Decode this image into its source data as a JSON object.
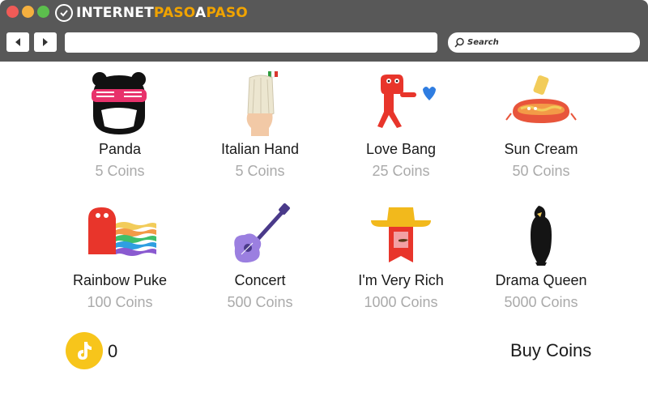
{
  "brand": {
    "name_part1": "INTERNET",
    "name_part2": "PASO",
    "name_part3": "A",
    "name_part4": "PASO",
    "accent_color": "#f0a300"
  },
  "toolbar": {
    "back_icon": "back-arrow-icon",
    "forward_icon": "forward-arrow-icon",
    "address_value": "",
    "search_placeholder": "Search"
  },
  "gifts": [
    {
      "name": "Panda",
      "price": "5 Coins",
      "icon": "panda-icon"
    },
    {
      "name": "Italian Hand",
      "price": "5 Coins",
      "icon": "italian-hand-icon"
    },
    {
      "name": "Love Bang",
      "price": "25 Coins",
      "icon": "love-bang-icon"
    },
    {
      "name": "Sun Cream",
      "price": "50 Coins",
      "icon": "sun-cream-icon"
    },
    {
      "name": "Rainbow Puke",
      "price": "100 Coins",
      "icon": "rainbow-puke-icon"
    },
    {
      "name": "Concert",
      "price": "500 Coins",
      "icon": "guitar-icon"
    },
    {
      "name": "I'm Very Rich",
      "price": "1000 Coins",
      "icon": "rich-man-icon"
    },
    {
      "name": "Drama Queen",
      "price": "5000 Coins",
      "icon": "drama-queen-icon"
    }
  ],
  "wallet": {
    "balance": "0",
    "coin_icon": "tiktok-coin-icon",
    "buy_label": "Buy Coins",
    "coin_color": "#f7c51b"
  }
}
